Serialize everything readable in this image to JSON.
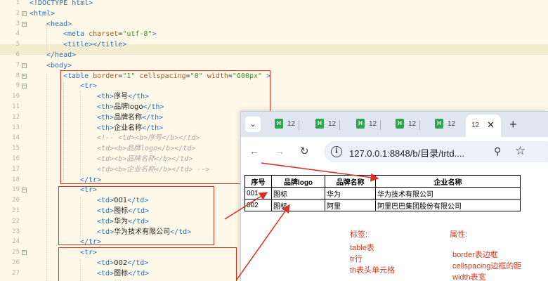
{
  "editor": {
    "lines": [
      {
        "n": "1",
        "fold": "",
        "indent": 0,
        "html": "<span class='tag'>&lt;!DOCTYPE html&gt;</span>"
      },
      {
        "n": "2",
        "fold": "⊟",
        "indent": 0,
        "html": "<span class='tag'>&lt;html&gt;</span>"
      },
      {
        "n": "3",
        "fold": "⊟",
        "indent": 1,
        "html": "<span class='tag'>&lt;head&gt;</span>"
      },
      {
        "n": "4",
        "fold": "",
        "indent": 2,
        "html": "<span class='tag'>&lt;meta </span><span class='attr'>charset</span>=<span class='str'>\"utf-8\"</span><span class='tag'>&gt;</span>"
      },
      {
        "n": "5",
        "fold": "",
        "indent": 2,
        "html": "<span class='tag'>&lt;title&gt;&lt;/title&gt;</span>"
      },
      {
        "n": "6",
        "fold": "",
        "indent": 1,
        "html": "<span class='tag'>&lt;/head&gt;</span>"
      },
      {
        "n": "7",
        "fold": "⊟",
        "indent": 1,
        "html": "<span class='tag'>&lt;body&gt;</span>"
      },
      {
        "n": "8",
        "fold": "⊟",
        "indent": 2,
        "html": "<span class='tag'>&lt;table </span><span class='attr'>border</span>=<span class='str'>\"1\"</span> <span class='attr'>cellspacing</span>=<span class='str'>\"0\"</span> <span class='attr'>width</span>=<span class='str'>\"600px\"</span> <span class='tag'>&gt;</span>"
      },
      {
        "n": "9",
        "fold": "⊟",
        "indent": 3,
        "html": "<span class='tag'>&lt;tr&gt;</span>"
      },
      {
        "n": "10",
        "fold": "",
        "indent": 4,
        "html": "<span class='tag'>&lt;th&gt;</span><span class='txt'>序号</span><span class='tag'>&lt;/th&gt;</span>"
      },
      {
        "n": "11",
        "fold": "",
        "indent": 4,
        "html": "<span class='tag'>&lt;th&gt;</span><span class='txt'>品牌logo</span><span class='tag'>&lt;/th&gt;</span>"
      },
      {
        "n": "12",
        "fold": "",
        "indent": 4,
        "html": "<span class='tag'>&lt;th&gt;</span><span class='txt'>品牌名称</span><span class='tag'>&lt;/th&gt;</span>"
      },
      {
        "n": "13",
        "fold": "",
        "indent": 4,
        "html": "<span class='tag'>&lt;th&gt;</span><span class='txt'>企业名称</span><span class='tag'>&lt;/th&gt;</span>"
      },
      {
        "n": "14",
        "fold": "",
        "indent": 4,
        "html": "<span class='cmt'>&lt;!-- &lt;td&gt;&lt;b&gt;序号&lt;/b&gt;&lt;/td&gt;</span>"
      },
      {
        "n": "15",
        "fold": "",
        "indent": 4,
        "html": "<span class='cmt'>&lt;td&gt;&lt;b&gt;品牌logo&lt;/b&gt;&lt;/td&gt;</span>"
      },
      {
        "n": "16",
        "fold": "",
        "indent": 4,
        "html": "<span class='cmt'>&lt;td&gt;&lt;b&gt;品牌名称&lt;/b&gt;&lt;/td&gt;</span>"
      },
      {
        "n": "17",
        "fold": "",
        "indent": 4,
        "html": "<span class='cmt'>&lt;td&gt;&lt;b&gt;企业名称&lt;/b&gt;&lt;/td&gt; --&gt;</span>"
      },
      {
        "n": "18",
        "fold": "",
        "indent": 3,
        "html": "<span class='tag'>&lt;/tr&gt;</span>"
      },
      {
        "n": "19",
        "fold": "⊟",
        "indent": 3,
        "html": "<span class='tag'>&lt;tr&gt;</span>"
      },
      {
        "n": "20",
        "fold": "",
        "indent": 4,
        "html": "<span class='tag'>&lt;td&gt;</span><span class='txt'>001</span><span class='tag'>&lt;/td&gt;</span>"
      },
      {
        "n": "21",
        "fold": "",
        "indent": 4,
        "html": "<span class='tag'>&lt;td&gt;</span><span class='txt'>图标</span><span class='tag'>&lt;/td&gt;</span>"
      },
      {
        "n": "22",
        "fold": "",
        "indent": 4,
        "html": "<span class='tag'>&lt;td&gt;</span><span class='txt'>华为</span><span class='tag'>&lt;/td&gt;</span>"
      },
      {
        "n": "23",
        "fold": "",
        "indent": 4,
        "html": "<span class='tag'>&lt;td&gt;</span><span class='txt'>华为技术有限公司</span><span class='tag'>&lt;/td&gt;</span>"
      },
      {
        "n": "24",
        "fold": "",
        "indent": 3,
        "html": "<span class='tag'>&lt;/tr&gt;</span>"
      },
      {
        "n": "25",
        "fold": "⊟",
        "indent": 3,
        "html": "<span class='tag'>&lt;tr&gt;</span>"
      },
      {
        "n": "26",
        "fold": "",
        "indent": 4,
        "html": "<span class='tag'>&lt;td&gt;</span><span class='txt'>002</span><span class='tag'>&lt;/td&gt;</span>"
      },
      {
        "n": "27",
        "fold": "",
        "indent": 4,
        "html": "<span class='tag'>&lt;td&gt;</span><span class='txt'>图标</span><span class='tag'>&lt;/td&gt;</span>"
      }
    ]
  },
  "browser": {
    "tabs": [
      {
        "label": "12"
      },
      {
        "label": "12"
      },
      {
        "label": "12"
      },
      {
        "label": "12"
      },
      {
        "label": "12"
      }
    ],
    "favicon_letter": "H",
    "active_tab": {
      "label": "12",
      "close": "✕"
    },
    "new_tab": "+",
    "url": "127.0.0.1:8848/b/目录/trtd....",
    "table": {
      "headers": [
        "序号",
        "品牌logo",
        "品牌名称",
        "企业名称"
      ],
      "rows": [
        [
          "001",
          "图标",
          "华为",
          "华为技术有限公司"
        ],
        [
          "002",
          "图标",
          "阿里",
          "阿里巴巴集团股份有限公司"
        ]
      ]
    }
  },
  "notes": {
    "tags_title": "标签:",
    "tags": [
      "table表",
      "tr行",
      "th表头单元格"
    ],
    "attrs_title": "属性:",
    "attrs": [
      "border表边框",
      "cellspacing边框的距",
      "width表宽"
    ]
  },
  "colors": {
    "annotation_red": "#d9301f",
    "favicon_green": "#2aa84a",
    "tabstrip_bg": "#dfe6f2"
  }
}
